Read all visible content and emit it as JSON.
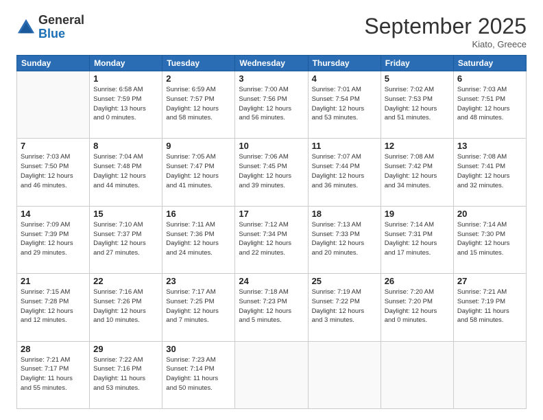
{
  "header": {
    "logo_general": "General",
    "logo_blue": "Blue",
    "month_title": "September 2025",
    "location": "Kiato, Greece"
  },
  "days_of_week": [
    "Sunday",
    "Monday",
    "Tuesday",
    "Wednesday",
    "Thursday",
    "Friday",
    "Saturday"
  ],
  "weeks": [
    [
      {
        "day": "",
        "info": ""
      },
      {
        "day": "1",
        "info": "Sunrise: 6:58 AM\nSunset: 7:59 PM\nDaylight: 13 hours\nand 0 minutes."
      },
      {
        "day": "2",
        "info": "Sunrise: 6:59 AM\nSunset: 7:57 PM\nDaylight: 12 hours\nand 58 minutes."
      },
      {
        "day": "3",
        "info": "Sunrise: 7:00 AM\nSunset: 7:56 PM\nDaylight: 12 hours\nand 56 minutes."
      },
      {
        "day": "4",
        "info": "Sunrise: 7:01 AM\nSunset: 7:54 PM\nDaylight: 12 hours\nand 53 minutes."
      },
      {
        "day": "5",
        "info": "Sunrise: 7:02 AM\nSunset: 7:53 PM\nDaylight: 12 hours\nand 51 minutes."
      },
      {
        "day": "6",
        "info": "Sunrise: 7:03 AM\nSunset: 7:51 PM\nDaylight: 12 hours\nand 48 minutes."
      }
    ],
    [
      {
        "day": "7",
        "info": "Sunrise: 7:03 AM\nSunset: 7:50 PM\nDaylight: 12 hours\nand 46 minutes."
      },
      {
        "day": "8",
        "info": "Sunrise: 7:04 AM\nSunset: 7:48 PM\nDaylight: 12 hours\nand 44 minutes."
      },
      {
        "day": "9",
        "info": "Sunrise: 7:05 AM\nSunset: 7:47 PM\nDaylight: 12 hours\nand 41 minutes."
      },
      {
        "day": "10",
        "info": "Sunrise: 7:06 AM\nSunset: 7:45 PM\nDaylight: 12 hours\nand 39 minutes."
      },
      {
        "day": "11",
        "info": "Sunrise: 7:07 AM\nSunset: 7:44 PM\nDaylight: 12 hours\nand 36 minutes."
      },
      {
        "day": "12",
        "info": "Sunrise: 7:08 AM\nSunset: 7:42 PM\nDaylight: 12 hours\nand 34 minutes."
      },
      {
        "day": "13",
        "info": "Sunrise: 7:08 AM\nSunset: 7:41 PM\nDaylight: 12 hours\nand 32 minutes."
      }
    ],
    [
      {
        "day": "14",
        "info": "Sunrise: 7:09 AM\nSunset: 7:39 PM\nDaylight: 12 hours\nand 29 minutes."
      },
      {
        "day": "15",
        "info": "Sunrise: 7:10 AM\nSunset: 7:37 PM\nDaylight: 12 hours\nand 27 minutes."
      },
      {
        "day": "16",
        "info": "Sunrise: 7:11 AM\nSunset: 7:36 PM\nDaylight: 12 hours\nand 24 minutes."
      },
      {
        "day": "17",
        "info": "Sunrise: 7:12 AM\nSunset: 7:34 PM\nDaylight: 12 hours\nand 22 minutes."
      },
      {
        "day": "18",
        "info": "Sunrise: 7:13 AM\nSunset: 7:33 PM\nDaylight: 12 hours\nand 20 minutes."
      },
      {
        "day": "19",
        "info": "Sunrise: 7:14 AM\nSunset: 7:31 PM\nDaylight: 12 hours\nand 17 minutes."
      },
      {
        "day": "20",
        "info": "Sunrise: 7:14 AM\nSunset: 7:30 PM\nDaylight: 12 hours\nand 15 minutes."
      }
    ],
    [
      {
        "day": "21",
        "info": "Sunrise: 7:15 AM\nSunset: 7:28 PM\nDaylight: 12 hours\nand 12 minutes."
      },
      {
        "day": "22",
        "info": "Sunrise: 7:16 AM\nSunset: 7:26 PM\nDaylight: 12 hours\nand 10 minutes."
      },
      {
        "day": "23",
        "info": "Sunrise: 7:17 AM\nSunset: 7:25 PM\nDaylight: 12 hours\nand 7 minutes."
      },
      {
        "day": "24",
        "info": "Sunrise: 7:18 AM\nSunset: 7:23 PM\nDaylight: 12 hours\nand 5 minutes."
      },
      {
        "day": "25",
        "info": "Sunrise: 7:19 AM\nSunset: 7:22 PM\nDaylight: 12 hours\nand 3 minutes."
      },
      {
        "day": "26",
        "info": "Sunrise: 7:20 AM\nSunset: 7:20 PM\nDaylight: 12 hours\nand 0 minutes."
      },
      {
        "day": "27",
        "info": "Sunrise: 7:21 AM\nSunset: 7:19 PM\nDaylight: 11 hours\nand 58 minutes."
      }
    ],
    [
      {
        "day": "28",
        "info": "Sunrise: 7:21 AM\nSunset: 7:17 PM\nDaylight: 11 hours\nand 55 minutes."
      },
      {
        "day": "29",
        "info": "Sunrise: 7:22 AM\nSunset: 7:16 PM\nDaylight: 11 hours\nand 53 minutes."
      },
      {
        "day": "30",
        "info": "Sunrise: 7:23 AM\nSunset: 7:14 PM\nDaylight: 11 hours\nand 50 minutes."
      },
      {
        "day": "",
        "info": ""
      },
      {
        "day": "",
        "info": ""
      },
      {
        "day": "",
        "info": ""
      },
      {
        "day": "",
        "info": ""
      }
    ]
  ]
}
